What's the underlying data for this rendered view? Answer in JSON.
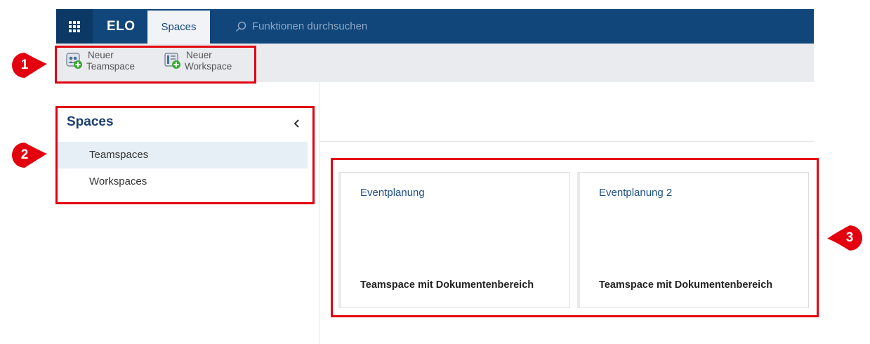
{
  "topbar": {
    "app_name": "ELO",
    "active_tab": "Spaces",
    "search_placeholder": "Funktionen durchsuchen",
    "color": "#10467a"
  },
  "ribbon": {
    "buttons": [
      {
        "line1": "Neuer",
        "line2": "Teamspace",
        "icon": "new-teamspace-icon"
      },
      {
        "line1": "Neuer",
        "line2": "Workspace",
        "icon": "new-workspace-icon"
      }
    ]
  },
  "sidebar": {
    "title": "Spaces",
    "items": [
      {
        "label": "Teamspaces",
        "active": true
      },
      {
        "label": "Workspaces",
        "active": false
      }
    ]
  },
  "cards": [
    {
      "title": "Eventplanung",
      "subtitle": "Teamspace mit Dokumentenbereich"
    },
    {
      "title": "Eventplanung 2",
      "subtitle": "Teamspace mit Dokumentenbereich"
    }
  ],
  "callouts": [
    "1",
    "2",
    "3"
  ],
  "colors": {
    "highlight": "#e3000f",
    "link": "#1e4f86",
    "accent_green": "#3aa935"
  }
}
